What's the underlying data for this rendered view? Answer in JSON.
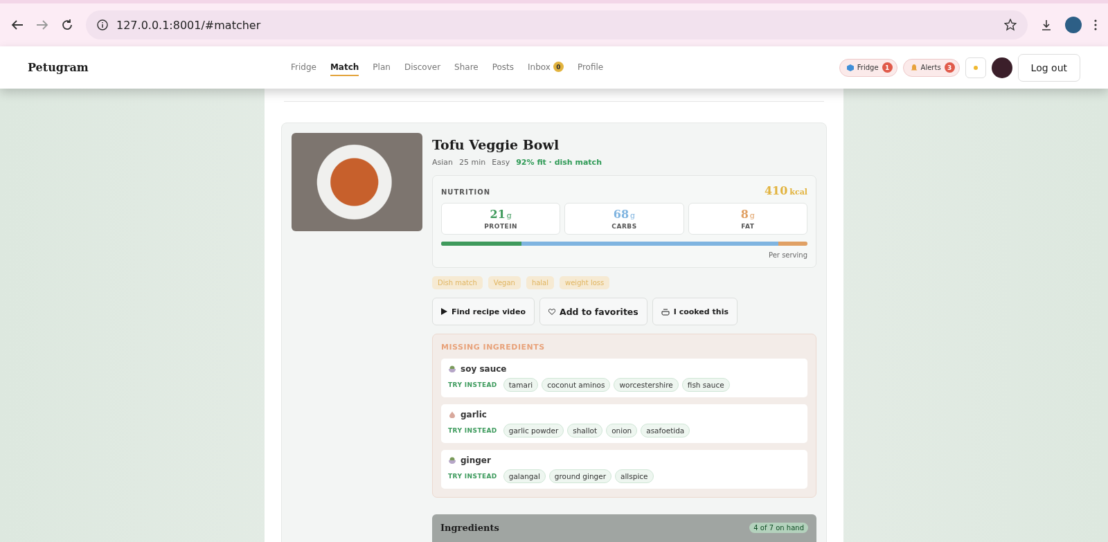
{
  "browser": {
    "url": "127.0.0.1:8001/#matcher"
  },
  "app": {
    "logo": "Petugram",
    "nav": [
      {
        "label": "Fridge",
        "selected": false
      },
      {
        "label": "Match",
        "selected": true
      },
      {
        "label": "Plan",
        "selected": false
      },
      {
        "label": "Discover",
        "selected": false
      },
      {
        "label": "Share",
        "selected": false
      },
      {
        "label": "Posts",
        "selected": false
      },
      {
        "label": "Inbox",
        "selected": false,
        "badge": "0"
      },
      {
        "label": "Profile",
        "selected": false
      }
    ],
    "pills": [
      {
        "kind": "fridge",
        "label": "Fridge",
        "badge": "1"
      },
      {
        "kind": "alerts",
        "label": "Alerts",
        "badge": "3"
      }
    ],
    "logout": "Log out"
  },
  "recipe": {
    "title": "Tofu Veggie Bowl",
    "meta": [
      "Asian",
      "25 min",
      "Easy"
    ],
    "fit": "92% fit · dish match",
    "nutrition": {
      "label": "NUTRITION",
      "kcal": "410",
      "kcal_unit": "kcal",
      "macros": [
        {
          "value": "21",
          "unit": "g",
          "label": "PROTEIN",
          "color": "#3f9a5c",
          "level": 0.22
        },
        {
          "value": "68",
          "unit": "g",
          "label": "CARBS",
          "color": "#7fb4e0",
          "level": 0.92
        },
        {
          "value": "8",
          "unit": "g",
          "label": "FAT",
          "color": "#e0a064",
          "level": 1
        }
      ],
      "note": "Per serving"
    },
    "tags": [
      "Dish match",
      "Vegan",
      "halal",
      "weight loss"
    ],
    "actions": [
      {
        "kind": "video",
        "label": "Find recipe video"
      },
      {
        "kind": "favorite",
        "label": "Add to favorites"
      },
      {
        "kind": "cooked",
        "label": "I cooked this"
      }
    ],
    "missing": {
      "title": "MISSING INGREDIENTS",
      "items": [
        {
          "name": "soy sauce",
          "kind": "bowl",
          "try_label": "TRY INSTEAD",
          "subs": [
            "tamari",
            "coconut aminos",
            "worcestershire",
            "fish sauce"
          ]
        },
        {
          "name": "garlic",
          "kind": "garlic",
          "try_label": "TRY INSTEAD",
          "subs": [
            "garlic powder",
            "shallot",
            "onion",
            "asafoetida"
          ]
        },
        {
          "name": "ginger",
          "kind": "bowl",
          "try_label": "TRY INSTEAD",
          "subs": [
            "galangal",
            "ground ginger",
            "allspice"
          ]
        }
      ]
    },
    "ingredients": {
      "title": "Ingredients",
      "count": "4 of 7 on hand"
    }
  }
}
